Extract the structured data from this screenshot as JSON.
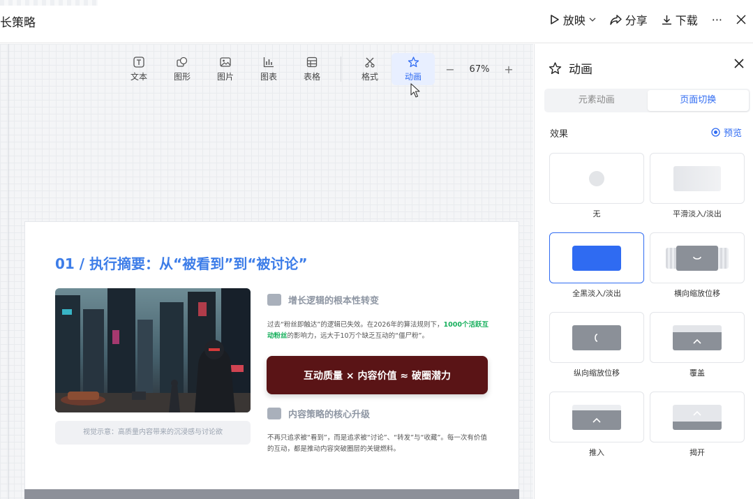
{
  "document": {
    "title": "长策略"
  },
  "top_actions": {
    "present": "放映",
    "share": "分享",
    "download": "下载",
    "more": "···"
  },
  "toolbar": {
    "items": [
      {
        "label": "文本",
        "icon": "text-icon"
      },
      {
        "label": "图形",
        "icon": "shape-icon"
      },
      {
        "label": "图片",
        "icon": "image-icon"
      },
      {
        "label": "图表",
        "icon": "chart-icon"
      },
      {
        "label": "表格",
        "icon": "table-icon"
      },
      {
        "label": "格式",
        "icon": "format-icon"
      },
      {
        "label": "动画",
        "icon": "animation-icon",
        "active": true
      }
    ],
    "zoom": "67%",
    "zoom_minus": "−",
    "zoom_plus": "+"
  },
  "slide": {
    "title": "01 / 执行摘要：从“被看到”到“被讨论”",
    "image_caption": "视觉示意：高质量内容带来的沉浸感与讨论欲",
    "section1": {
      "heading": "增长逻辑的根本性转变",
      "text_a": "过去“粉丝即触达”的逻辑已失效。在2026年的算法规则下，",
      "highlight": "1000个活跃互动粉丝",
      "text_b": "的影响力，远大于10万个缺乏互动的“僵尸粉”。"
    },
    "formula": "互动质量 × 内容价值 ≈ 破圈潜力",
    "section2": {
      "heading": "内容策略的核心升级",
      "text": "不再只追求被“看到”，而是追求被“讨论”、“转发”与“收藏”。每一次有价值的互动，都是推动内容突破圈层的关键燃料。"
    }
  },
  "panel": {
    "title": "动画",
    "tabs": [
      {
        "label": "元素动画",
        "active": false
      },
      {
        "label": "页面切换",
        "active": true
      }
    ],
    "effects_label": "效果",
    "preview_label": "预览",
    "effects": [
      {
        "label": "无",
        "thumb": "none"
      },
      {
        "label": "平滑淡入/淡出",
        "thumb": "fade"
      },
      {
        "label": "全黑淡入/淡出",
        "thumb": "black",
        "selected": true
      },
      {
        "label": "横向缩放位移",
        "thumb": "hzoom"
      },
      {
        "label": "纵向缩放位移",
        "thumb": "vzoom"
      },
      {
        "label": "覆盖",
        "thumb": "cover"
      },
      {
        "label": "推入",
        "thumb": "push"
      },
      {
        "label": "揭开",
        "thumb": "reveal"
      }
    ]
  },
  "colors": {
    "accent": "#2f6bf2",
    "slide_title": "#3d7de8",
    "formula_bg": "#5a1416",
    "highlight": "#18b05d"
  }
}
